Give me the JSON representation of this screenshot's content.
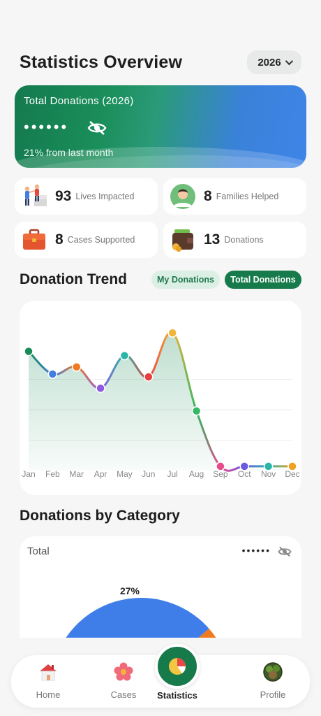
{
  "header": {
    "title": "Statistics Overview",
    "year": "2026"
  },
  "donation_card": {
    "title": "Total Donations (2026)",
    "masked_amount": "••••••",
    "change_text": "21% from last month"
  },
  "stats": [
    {
      "value": "93",
      "label": "Lives Impacted",
      "icon": "people-icon"
    },
    {
      "value": "8",
      "label": "Families Helped",
      "icon": "family-avatar-icon"
    },
    {
      "value": "8",
      "label": "Cases Supported",
      "icon": "briefcase-icon"
    },
    {
      "value": "13",
      "label": "Donations",
      "icon": "wallet-icon"
    }
  ],
  "trend": {
    "title": "Donation Trend",
    "tab_my": "My Donations",
    "tab_total": "Total Donations",
    "active_tab": "Total Donations"
  },
  "chart_data": {
    "type": "line",
    "title": "Donation Trend",
    "categories": [
      "Jan",
      "Feb",
      "Mar",
      "Apr",
      "May",
      "Jun",
      "Jul",
      "Aug",
      "Sep",
      "Oct",
      "Nov",
      "Dec"
    ],
    "values": [
      84,
      68,
      73,
      58,
      81,
      66,
      97,
      42,
      3,
      3,
      3,
      3
    ],
    "ylim": [
      0,
      100
    ],
    "grid": true,
    "point_colors": [
      "#1a8a56",
      "#3f7fe0",
      "#f07a22",
      "#8e5ae0",
      "#2ab5a8",
      "#e84040",
      "#f2b33a",
      "#33b864",
      "#e84a8e",
      "#6a5ae0",
      "#2ab5a8",
      "#f2a020"
    ],
    "fill_color": "#1a8a56"
  },
  "category": {
    "title": "Donations by Category",
    "total_label": "Total",
    "masked_amount": "••••••",
    "chart": {
      "type": "pie",
      "slices": [
        {
          "percent": 27,
          "label": "27%",
          "color": "#3f7ee8"
        },
        {
          "percent": 10,
          "label": "",
          "color": "#f07a1e"
        }
      ]
    }
  },
  "nav": {
    "items": [
      {
        "label": "Home",
        "icon": "home-icon"
      },
      {
        "label": "Cases",
        "icon": "flower-icon"
      },
      {
        "label": "Statistics",
        "icon": "pie-chart-icon",
        "active": true
      },
      {
        "label": "Profile",
        "icon": "profile-avatar-icon"
      }
    ]
  }
}
